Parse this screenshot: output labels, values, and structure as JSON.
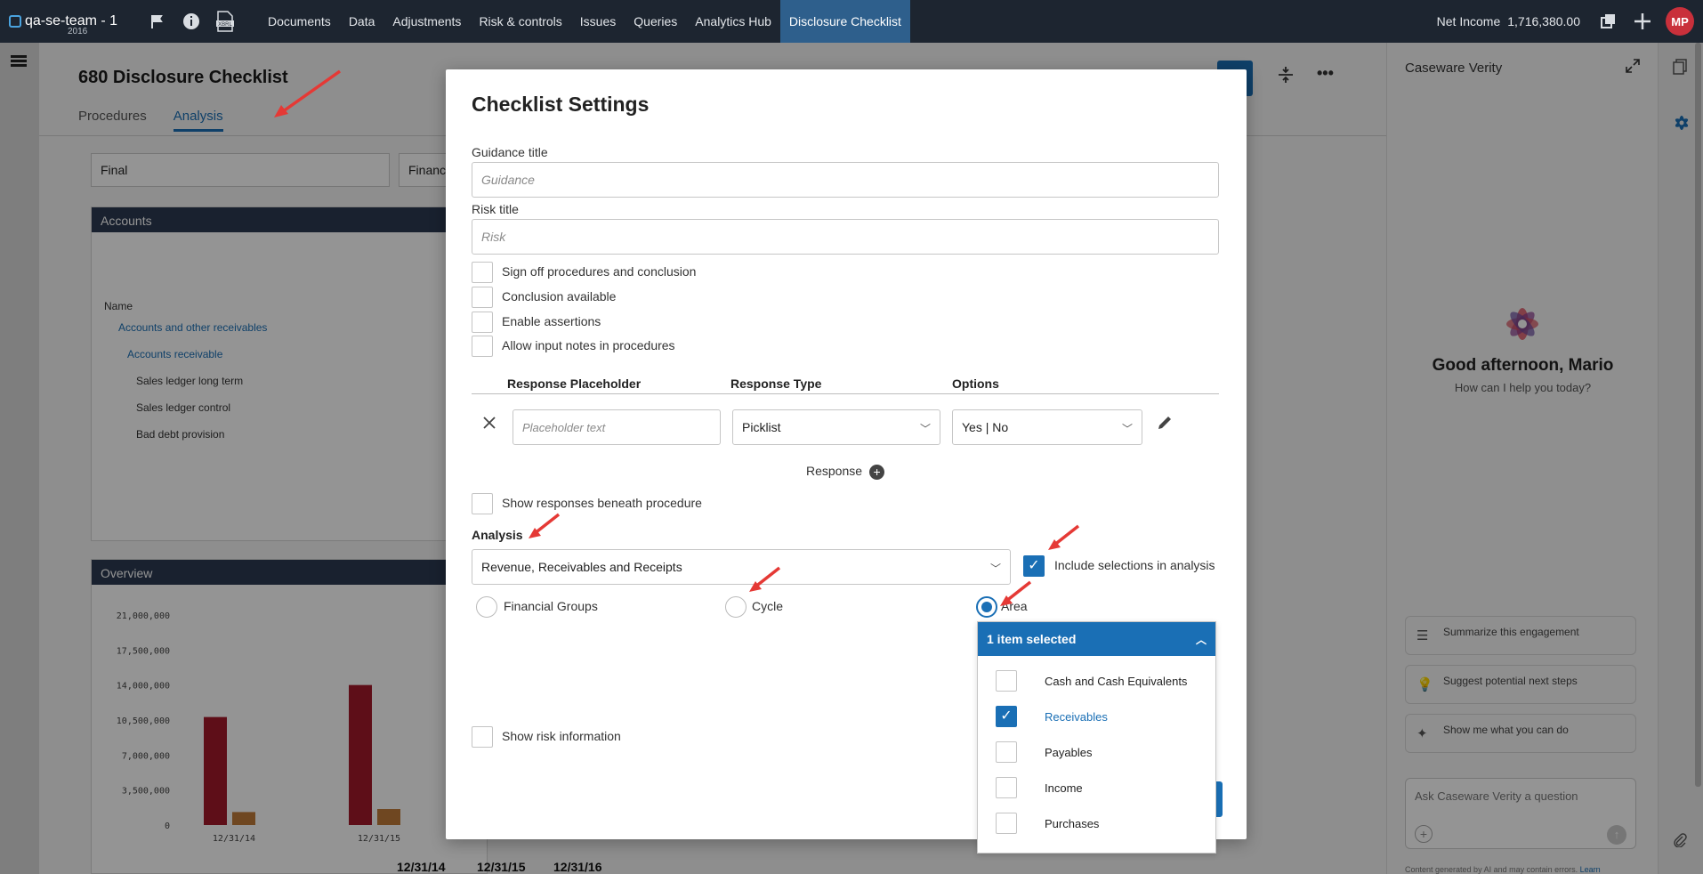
{
  "topbar": {
    "engagement_name": "qa-se-team - 1",
    "engagement_year": "2016",
    "nav": [
      "Documents",
      "Data",
      "Adjustments",
      "Risk & controls",
      "Issues",
      "Queries",
      "Analytics Hub",
      "Disclosure Checklist"
    ],
    "active_nav": "Disclosure Checklist",
    "net_income_label": "Net Income",
    "net_income_value": "1,716,380.00",
    "avatar_initials": "MP",
    "icons": [
      "flag-icon",
      "info-icon",
      "xbrl-icon",
      "copy-icon",
      "plus-icon"
    ]
  },
  "page": {
    "title": "680 Disclosure Checklist",
    "tabs": [
      "Procedures",
      "Analysis"
    ],
    "active_tab": "Analysis",
    "filter_final": "Final",
    "filter_second": "Financ",
    "accounts_panel_title": "Accounts",
    "accounts_name_header": "Name",
    "accounts_rows": [
      "Accounts and other receivables",
      "Accounts receivable",
      "Sales ledger long term",
      "Sales ledger control",
      "Bad debt provision"
    ],
    "overview_panel_title": "Overview",
    "bottom_dates": [
      "12/31/14",
      "12/31/15",
      "12/31/16"
    ]
  },
  "chart_data": {
    "type": "bar",
    "categories": [
      "12/31/14",
      "12/31/15"
    ],
    "series": [
      {
        "values": [
          10800000,
          14000000
        ],
        "color": "#a3192a"
      },
      {
        "values": [
          1300000,
          1600000
        ],
        "color": "#c07a3a"
      }
    ],
    "y_ticks": [
      "21,000,000",
      "17,500,000",
      "14,000,000",
      "10,500,000",
      "7,000,000",
      "3,500,000",
      "0"
    ],
    "ylim": [
      0,
      21000000
    ]
  },
  "modal": {
    "title": "Checklist Settings",
    "guidance_label": "Guidance title",
    "guidance_placeholder": "Guidance",
    "risk_label": "Risk title",
    "risk_placeholder": "Risk",
    "checkboxes": [
      {
        "label": "Sign off procedures and conclusion",
        "checked": false
      },
      {
        "label": "Conclusion available",
        "checked": false
      },
      {
        "label": "Enable assertions",
        "checked": false
      },
      {
        "label": "Allow input notes in procedures",
        "checked": false
      }
    ],
    "response_columns": [
      "Response Placeholder",
      "Response Type",
      "Options"
    ],
    "response_placeholder": "Placeholder text",
    "response_type_value": "Picklist",
    "options_value": "Yes | No",
    "add_response_label": "Response",
    "show_responses_label": "Show responses beneath procedure",
    "analysis_label": "Analysis",
    "analysis_value": "Revenue, Receivables and Receipts",
    "include_selections_label": "Include selections in analysis",
    "include_selections_checked": true,
    "radios": [
      {
        "label": "Financial Groups",
        "selected": false
      },
      {
        "label": "Cycle",
        "selected": false
      },
      {
        "label": "Area",
        "selected": true
      }
    ],
    "dropdown_header": "1 item selected",
    "dropdown_items": [
      {
        "label": "Cash and Cash Equivalents",
        "checked": false
      },
      {
        "label": "Receivables",
        "checked": true
      },
      {
        "label": "Payables",
        "checked": false
      },
      {
        "label": "Income",
        "checked": false
      },
      {
        "label": "Purchases",
        "checked": false
      }
    ],
    "show_risk_label": "Show risk information"
  },
  "verity": {
    "title": "Caseware Verity",
    "greeting": "Good afternoon, Mario",
    "subtitle": "How can I help you today?",
    "suggestions": [
      "Summarize this engagement",
      "Suggest potential next steps",
      "Show me what you can do"
    ],
    "ask_placeholder": "Ask Caseware Verity a question",
    "footer_text": "Content generated by AI and may contain errors.",
    "footer_link": "Learn"
  },
  "colors": {
    "topbar": "#1d2530",
    "accent": "#1a6fb5",
    "annotation_arrow": "#e53935"
  }
}
